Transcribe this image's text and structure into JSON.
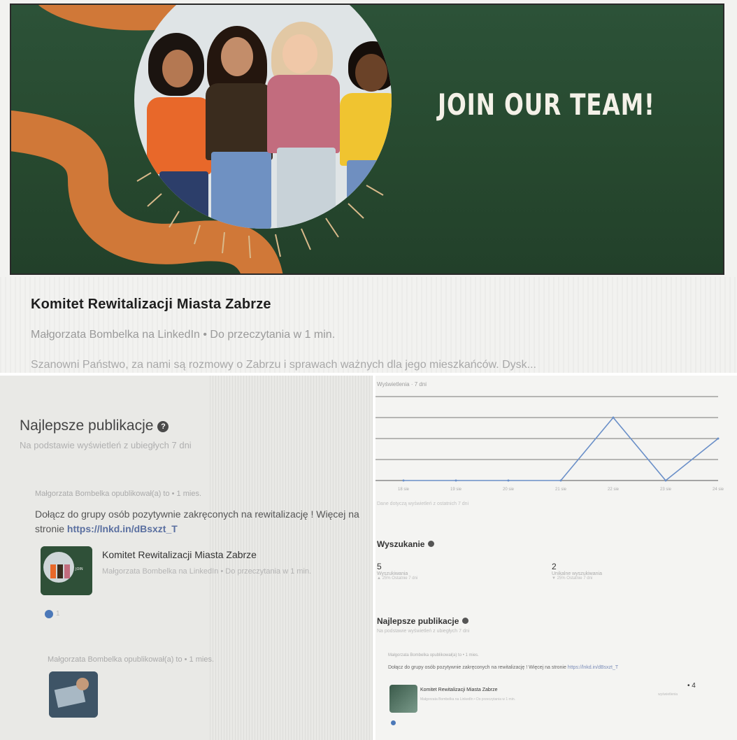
{
  "banner": {
    "headline": "JOIN OUR TEAM!",
    "colors": {
      "green": "#27492f",
      "orange": "#d07838"
    }
  },
  "article": {
    "title": "Komitet Rewitalizacji Miasta Zabrze",
    "subtitle": "Małgorzata Bombelka na LinkedIn • Do przeczytania w 1 min.",
    "description": "Szanowni Państwo, za nami są rozmowy o Zabrzu i sprawach ważnych dla jego mieszkańców. Dysk..."
  },
  "top_posts_left": {
    "title": "Najlepsze publikacje",
    "help_icon": "question-circle-icon",
    "basis": "Na podstawie wyświetleń z ubiegłych 7 dni",
    "post1": {
      "meta": "Małgorzata Bombelka opublikował(a) to • 1 mies.",
      "text": "Dołącz do grupy osób pozytywnie zakręconych na rewitalizację ! Więcej na",
      "text2": "stronie ",
      "link": "https://lnkd.in/dBsxzt_T",
      "card_title": "Komitet Rewitalizacji Miasta Zabrze",
      "card_sub": "Małgorzata Bombelka na LinkedIn • Do przeczytania w 1 min.",
      "reactions": "1"
    },
    "post2": {
      "meta": "Małgorzata Bombelka opublikował(a) to • 1 mies."
    }
  },
  "right_panel": {
    "chart_label": "Wyświetlenia · 7 dni",
    "chart_footer": "Dane dotyczą wyświetleń z ostatnich 7 dni",
    "search": {
      "title": "Wyszukanie",
      "stat1": {
        "value": "5",
        "label": "Wyszukiwania",
        "change": "▲ 25% Ostatnie 7 dni"
      },
      "stat2": {
        "value": "2",
        "label": "Unikalne wyszukiwania",
        "change": "▼ 25% Ostatnie 7 dni"
      }
    },
    "top_posts": {
      "title": "Najlepsze publikacje",
      "basis": "Na podstawie wyświetleń z ubiegłych 7 dni",
      "meta": "Małgorzata Bombelka opublikował(a) to • 1 mies.",
      "text": "Dołącz do grupy osób pozytywnie zakręconych na rewitalizację ! Więcej na stronie ",
      "link": "https://lnkd.in/dBsxzt_T",
      "card_title": "Komitet Rewitalizacji Miasta Zabrze",
      "card_sub": "Małgorzata Bombelka na LinkedIn • Do przeczytania w 1 min.",
      "impressions": "4",
      "impressions_label": "wyświetlenia"
    }
  },
  "chart_data": {
    "type": "line",
    "categories": [
      "18 sie",
      "19 sie",
      "20 sie",
      "21 sie",
      "22 sie",
      "23 sie",
      "24 sie"
    ],
    "values": [
      0,
      0,
      0,
      0,
      3,
      0,
      2
    ],
    "ylim": [
      0,
      4
    ],
    "grid": true,
    "color": "#6a8fc8"
  }
}
